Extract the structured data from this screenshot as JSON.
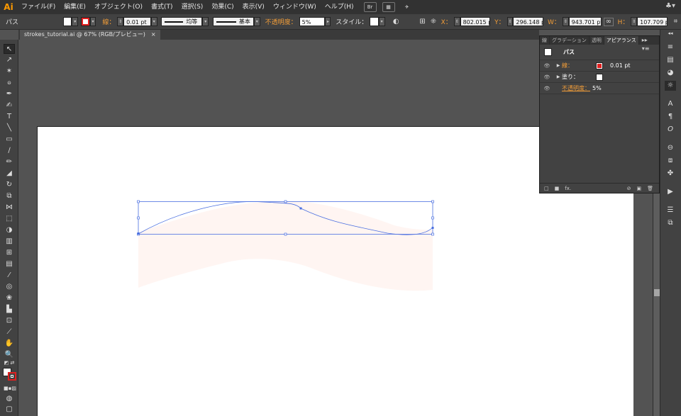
{
  "app": {
    "logo": "Ai",
    "accent": "#ff9a00"
  },
  "menu": {
    "items": [
      "ファイル(F)",
      "編集(E)",
      "オブジェクト(O)",
      "書式(T)",
      "選択(S)",
      "効果(C)",
      "表示(V)",
      "ウィンドウ(W)",
      "ヘルプ(H)"
    ],
    "bridge_button": "Br",
    "right_icon": "♣▾"
  },
  "control": {
    "object_type": "パス",
    "stroke_label": "線：",
    "stroke_weight": "0.01 pt",
    "variable_width": "均等",
    "brush": "基本",
    "opacity_label": "不透明度：",
    "opacity": "5%",
    "style_label": "スタイル：",
    "x_label": "X：",
    "x": "802.015 pt",
    "y_label": "Y：",
    "y": "296.148 pt",
    "w_label": "W：",
    "w": "943.701 pt",
    "h_label": "H：",
    "h": "107.709 pt"
  },
  "document": {
    "tab_title": "strokes_tutorial.ai @ 67% (RGB/プレビュー)",
    "close": "×"
  },
  "panel": {
    "tabs": [
      "線",
      "グラデーション",
      "透明",
      "アピアランス"
    ],
    "active_tab": 3,
    "menu_glyph": "▸▸ ▾≡",
    "header_title": "パス",
    "rows": [
      {
        "label": "線：",
        "value": "0.01 pt",
        "swatch": "#e02020",
        "expandable": true
      },
      {
        "label": "塗り：",
        "value": "",
        "swatch": "#ffffff",
        "expandable": true
      },
      {
        "label": "不透明度：",
        "value": "5%",
        "expandable": false
      }
    ],
    "footer_fx": "fx.",
    "footer_icons": [
      "⊘",
      "▣",
      "🗑"
    ]
  },
  "colors": {
    "selection": "#4a6fe0",
    "stroke_swatch": "#e02020"
  }
}
